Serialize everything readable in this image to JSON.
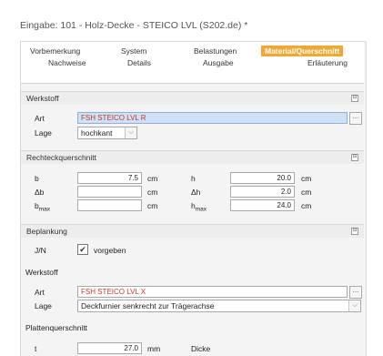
{
  "window": {
    "title": "Eingabe: 101 - Holz-Decke - STEICO LVL (S202.de) *"
  },
  "tabs": {
    "row1": [
      "Vorbemerkung",
      "System",
      "Belastungen",
      "Material/Querschnitt"
    ],
    "row2": [
      "Nachweise",
      "Details",
      "Ausgabe",
      "Erläuterung"
    ],
    "active": "Material/Querschnitt"
  },
  "werkstoff1": {
    "header": "Werkstoff",
    "art_label": "Art",
    "art_value": "FSH STEICO LVL R",
    "lage_label": "Lage",
    "lage_value": "hochkant"
  },
  "rechteck": {
    "header": "Rechteckquerschnitt",
    "b_label": "b",
    "b_value": "7.5",
    "b_unit": "cm",
    "db_label": "Δb",
    "db_value": "",
    "db_unit": "cm",
    "bmax_label": "b",
    "bmax_sub": "max",
    "bmax_value": "",
    "bmax_unit": "cm",
    "h_label": "h",
    "h_value": "20.0",
    "h_unit": "cm",
    "dh_label": "Δh",
    "dh_value": "2.0",
    "dh_unit": "cm",
    "hmax_label": "h",
    "hmax_sub": "max",
    "hmax_value": "24.0",
    "hmax_unit": "cm"
  },
  "beplankung": {
    "header": "Beplankung",
    "jn_label": "J/N",
    "checked": true,
    "check_glyph": "✔",
    "check_label": "vorgeben"
  },
  "werkstoff2": {
    "header": "Werkstoff",
    "art_label": "Art",
    "art_value": "FSH STEICO LVL X",
    "lage_label": "Lage",
    "lage_value": "Deckfurnier senkrecht zur Trägerachse"
  },
  "platten": {
    "header": "Plattenquerschnitt",
    "t_label": "t",
    "t_value": "27.0",
    "t_unit": "mm",
    "t_desc": "Dicke"
  },
  "icons": {
    "ellipsis": "...",
    "dropdown": "⌵",
    "collapse": "⊟"
  }
}
